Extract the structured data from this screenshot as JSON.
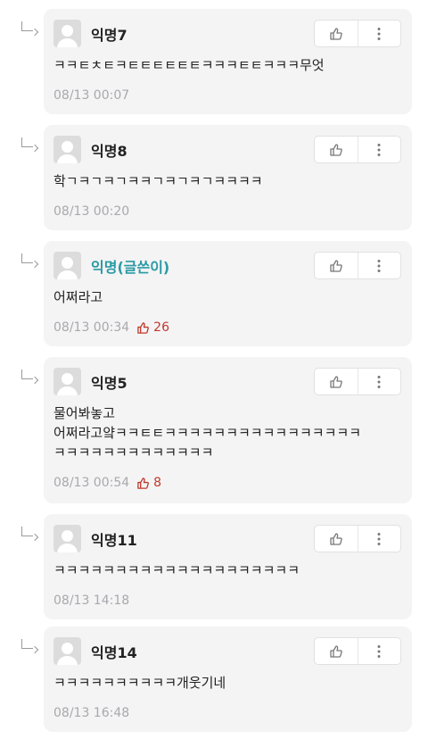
{
  "comments": [
    {
      "author": "익명7",
      "is_writer": false,
      "text": "ㅋㅋㅌㅊㅌㅋㅌㅌㅌㅌㅌㅌㅋㅋㅋㅌㅌㅋㅋㅋ무엇",
      "time": "08/13 00:07",
      "likes": ""
    },
    {
      "author": "익명8",
      "is_writer": false,
      "text": "학ㄱㅋㄱㅋㄱㅋㅋㄱㅋㄱㅋㄱㅋㅋㅋㅋ",
      "time": "08/13 00:20",
      "likes": ""
    },
    {
      "author": "익명(글쓴이)",
      "is_writer": true,
      "text": "어쩌라고",
      "time": "08/13 00:34",
      "likes": "26"
    },
    {
      "author": "익명5",
      "is_writer": false,
      "text": "물어봐놓고\n어쩌라고얔ㅋㅋㅌㅌㅋㅋㅋㅋㅋㅋㅋㅋㅋㅋㅋㅋㅋㅋㅋㅋ\nㅋㅋㅋㅋㅋㅋㅋㅋㅋㅋㅋㅋㅋ",
      "time": "08/13 00:54",
      "likes": "8"
    },
    {
      "author": "익명11",
      "is_writer": false,
      "text": "ㅋㅋㅋㅋㅋㅋㅋㅋㅋㅋㅋㅋㅋㅋㅋㅋㅋㅋㅋㅋ",
      "time": "08/13 14:18",
      "likes": ""
    },
    {
      "author": "익명14",
      "is_writer": false,
      "text": "ㅋㅋㅋㅋㅋㅋㅋㅋㅋㅋ개웃기네",
      "time": "08/13 16:48",
      "likes": ""
    }
  ],
  "icons": {
    "reply_arrow": "reply-arrow-icon",
    "avatar": "default-avatar-icon",
    "like": "thumbs-up-icon",
    "more": "more-vertical-icon"
  },
  "colors": {
    "writer_name": "#2a9aa5",
    "like_count": "#c0392b",
    "meta_text": "#a9a9ad",
    "card_bg": "#f4f4f5"
  }
}
